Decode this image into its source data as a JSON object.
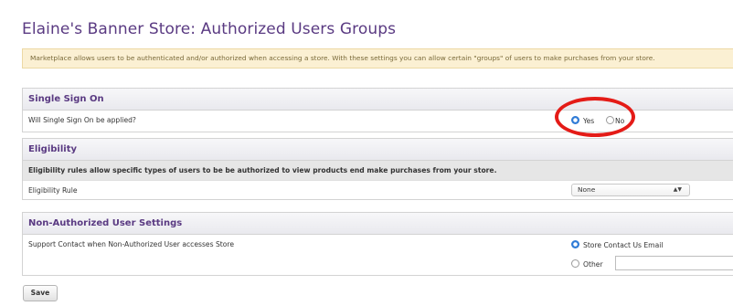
{
  "page_title": "Elaine's Banner Store: Authorized Users Groups",
  "notice_text": "Marketplace allows users to be authenticated and/or authorized when accessing a store. With these settings you can allow certain \"groups\" of users to make purchases from your store.",
  "sso": {
    "title": "Single Sign On",
    "question": "Will Single Sign On be applied?",
    "options": [
      "Yes",
      "No"
    ],
    "selected": "Yes"
  },
  "eligibility": {
    "title": "Eligibility",
    "description": "Eligibility rules allow specific types of users to be be authorized to view products end make purchases from your store.",
    "rule_label": "Eligibility Rule",
    "rule_value": "None"
  },
  "non_auth": {
    "title": "Non-Authorized User Settings",
    "support_label": "Support Contact when Non-Authorized User accesses Store",
    "options": [
      "Store Contact Us Email",
      "Other"
    ],
    "selected": "Store Contact Us Email",
    "other_value": ""
  },
  "save_label": "Save",
  "colors": {
    "title": "#5a3a82",
    "notice_bg": "#fbf0d3",
    "radio_on": "#2f7bd6",
    "highlight": "#e41b17"
  }
}
